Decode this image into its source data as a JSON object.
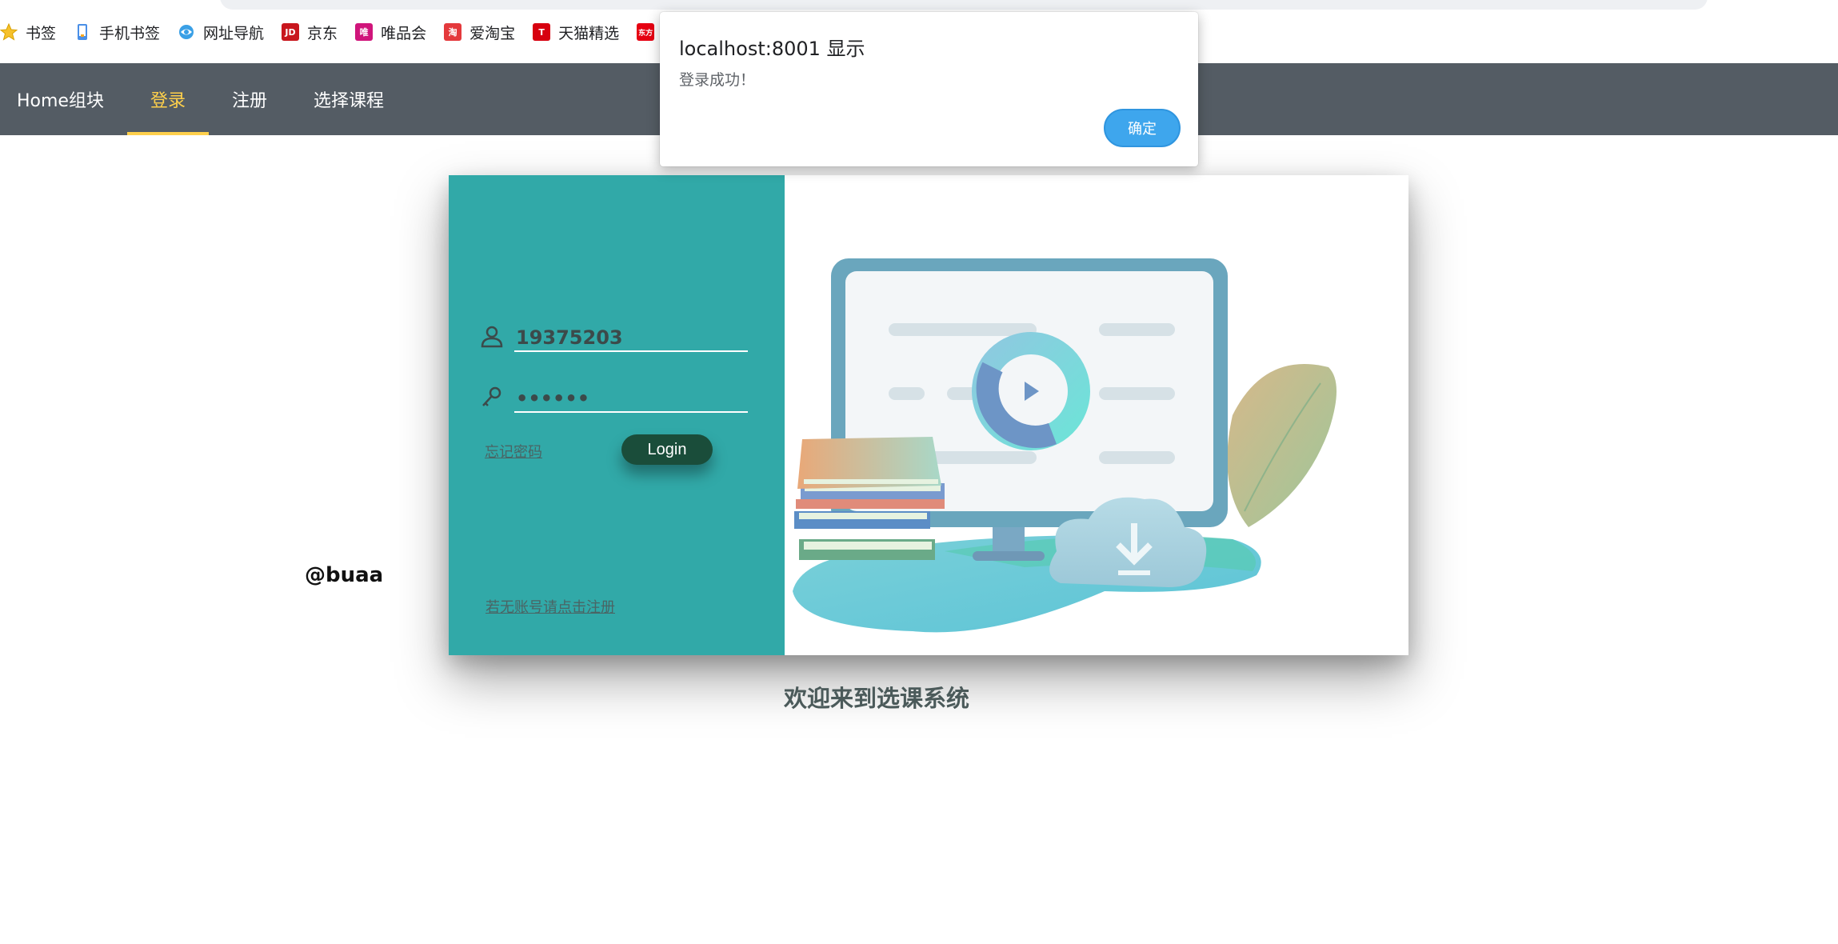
{
  "bookmarks": [
    {
      "label": "书签",
      "icon": "star-icon"
    },
    {
      "label": "手机书签",
      "icon": "phone-icon"
    },
    {
      "label": "网址导航",
      "icon": "nav-icon"
    },
    {
      "label": "京东",
      "icon": "jd-icon",
      "badge": "JD"
    },
    {
      "label": "唯品会",
      "icon": "vip-icon",
      "badge": "唯"
    },
    {
      "label": "爱淘宝",
      "icon": "taobao-icon",
      "badge": "淘"
    },
    {
      "label": "天猫精选",
      "icon": "tmall-icon",
      "badge": "T"
    },
    {
      "label": "",
      "icon": "dongfang-icon",
      "badge": "东方"
    }
  ],
  "nav": {
    "items": [
      "Home组块",
      "登录",
      "注册",
      "选择课程"
    ],
    "active_index": 1,
    "bg_color": "#545c64",
    "active_color": "#ffd04b"
  },
  "login": {
    "username": "19375203",
    "password_mask": "••••••",
    "forgot_label": "忘记密码",
    "login_label": "Login",
    "register_link": "若无账号请点击注册",
    "panel_color": "#31a9a8"
  },
  "footer": {
    "buaa": "@buaa",
    "welcome": "欢迎来到选课系统"
  },
  "dialog": {
    "title": "localhost:8001 显示",
    "message": "登录成功！",
    "ok_label": "确定"
  }
}
